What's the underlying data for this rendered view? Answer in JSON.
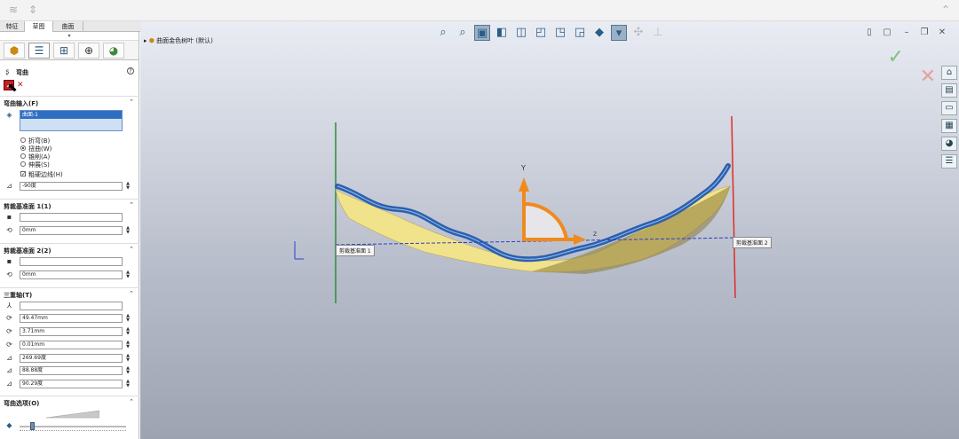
{
  "tabs": [
    "特征",
    "草图",
    "曲面"
  ],
  "collapse_arrow": "▾",
  "tree": {
    "label": "曲面金色树叶 (默认)"
  },
  "panel": {
    "title": "弯曲",
    "help": "?",
    "ok_label": "✓",
    "cancel_label": "✕",
    "bend_input": {
      "title": "弯曲输入(F)",
      "selection": "曲面-1",
      "options": [
        {
          "label": "折弯(B)",
          "checked": false
        },
        {
          "label": "扭曲(W)",
          "checked": true
        },
        {
          "label": "锥削(A)",
          "checked": false
        },
        {
          "label": "伸展(S)",
          "checked": false
        }
      ],
      "hard_edges": {
        "label": "粗硬边线(H)",
        "checked": true
      },
      "angle": "-90度"
    },
    "trim_plane1": {
      "title": "剪裁基准面 1(1)",
      "ref": "",
      "distance": "0mm"
    },
    "trim_plane2": {
      "title": "剪裁基准面 2(2)",
      "ref": "",
      "distance": "0mm"
    },
    "triad": {
      "title": "三重轴(T)",
      "ref": "",
      "values": [
        "49.47mm",
        "3.71mm",
        "0.01mm",
        "269.69度",
        "88.88度",
        "90.29度"
      ]
    },
    "bend_options": {
      "title": "弯曲选项(O)",
      "slider_value": 0.1
    }
  },
  "viewport": {
    "axis_y": "Y",
    "axis_z": "Z",
    "plane1": "剪裁基准面 1",
    "plane2": "剪裁基准面 2",
    "colors": {
      "leaf": "#f1e38b",
      "ribbon": "#2e5fae",
      "manip": "#f08a1d",
      "plane1": "#2a8c3a",
      "plane2": "#e02a2a"
    }
  }
}
